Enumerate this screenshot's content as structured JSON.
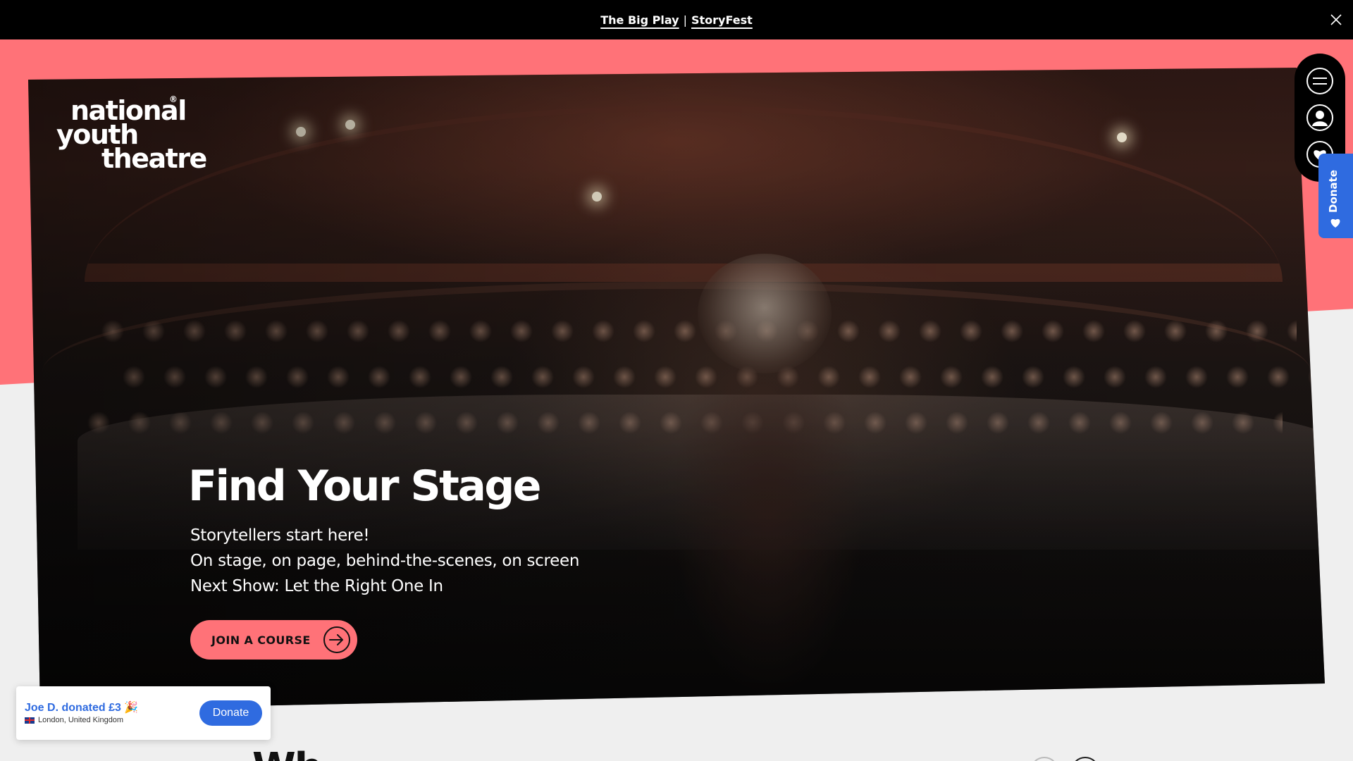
{
  "announcement": {
    "link1": "The Big Play",
    "separator": "|",
    "link2": "StoryFest"
  },
  "logo": {
    "line1": "national",
    "line2": "youth",
    "line3": "theatre",
    "mark": "®"
  },
  "hero": {
    "title": "Find Your Stage",
    "lines": [
      "Storytellers start here!",
      "On stage, on page, behind-the-scenes, on screen",
      "Next Show: Let the Right One In"
    ],
    "cta_label": "JOIN A COURSE"
  },
  "side_nav": {
    "icons": [
      "menu-icon",
      "account-icon",
      "heart-icon"
    ]
  },
  "donate_tab": {
    "label": "Donate"
  },
  "toast": {
    "donor": "Joe D. donated £3 🎉",
    "location": "London, United Kingdom",
    "button": "Donate"
  },
  "next_section": {
    "heading_partial": "Wh"
  },
  "colors": {
    "coral": "#ff7278",
    "donate_blue": "#2f6be0",
    "black": "#000000"
  }
}
